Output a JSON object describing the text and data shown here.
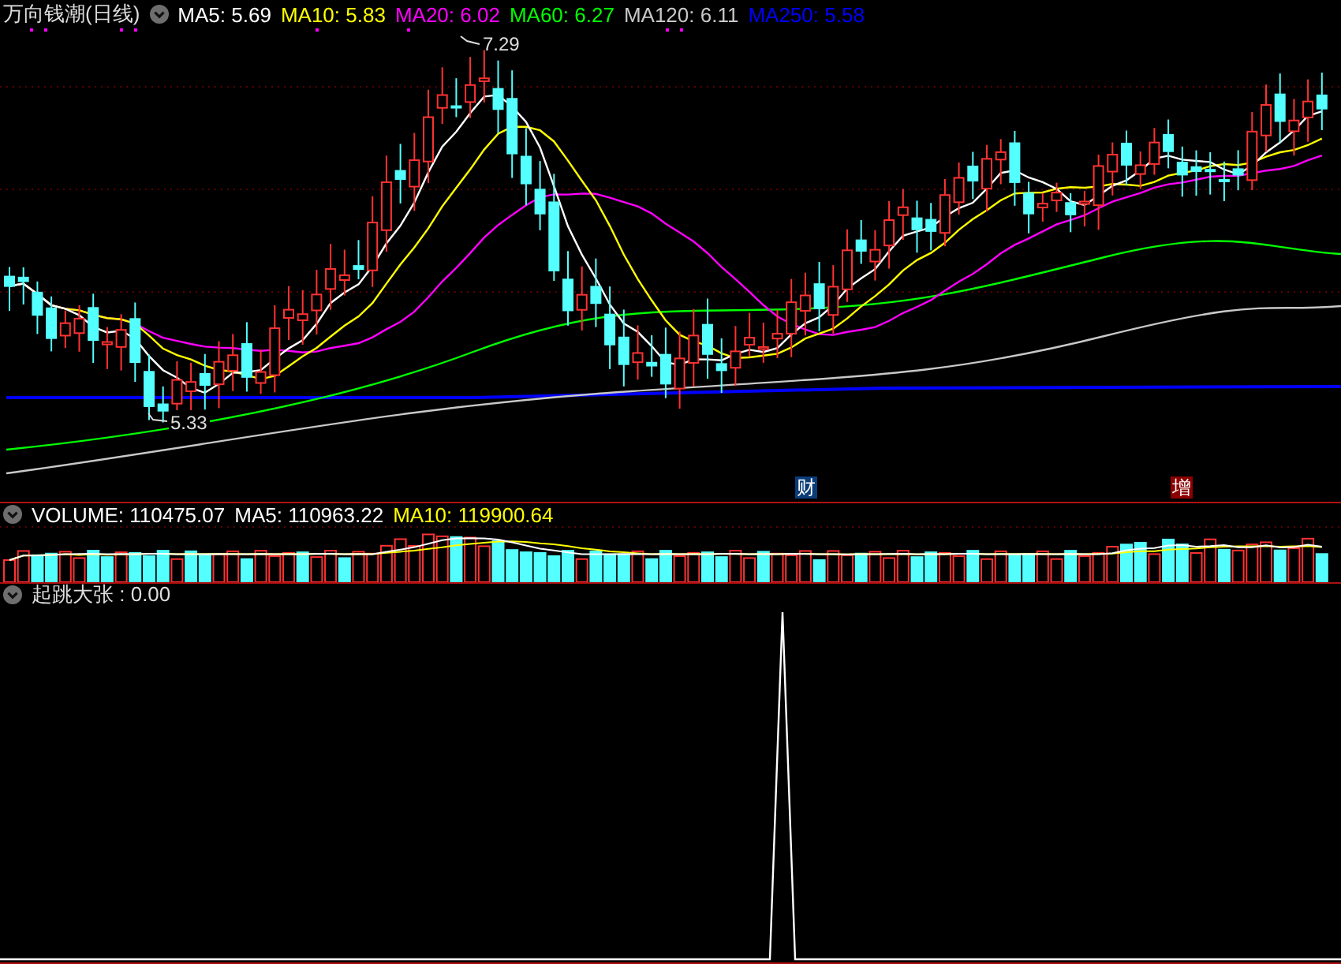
{
  "header": {
    "title": "万向钱潮(日线)",
    "ma": [
      {
        "label": "MA5: 5.69",
        "color": "#ffffff"
      },
      {
        "label": "MA10: 5.83",
        "color": "#ffff00"
      },
      {
        "label": "MA20: 6.02",
        "color": "#ff00ff"
      },
      {
        "label": "MA60: 6.27",
        "color": "#00ff00"
      },
      {
        "label": "MA120: 6.11",
        "color": "#c8c8c8"
      },
      {
        "label": "MA250: 5.58",
        "color": "#0000ff"
      }
    ]
  },
  "price_chart": {
    "high_label": "7.29",
    "low_label": "5.33",
    "events": [
      {
        "text": "财",
        "color": "#0a3c78"
      },
      {
        "text": "增",
        "color": "#8b0000"
      }
    ]
  },
  "volume_panel": {
    "items": [
      {
        "label": "VOLUME: 110475.07",
        "color": "#ffffff"
      },
      {
        "label": "MA5: 110963.22",
        "color": "#ffffff"
      },
      {
        "label": "MA10: 119900.64",
        "color": "#ffff00"
      }
    ]
  },
  "indicator_panel": {
    "label": "起跳大张 : 0.00"
  }
}
